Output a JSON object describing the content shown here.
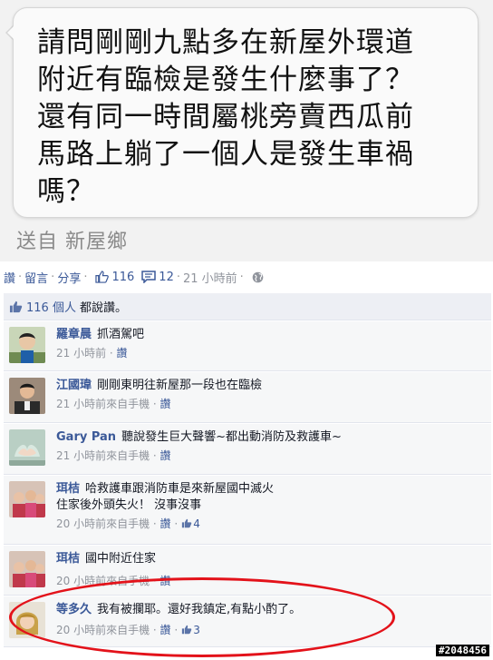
{
  "message": {
    "lines": [
      "請問剛剛九點多在新屋外環道",
      "附近有臨檢是發生什麼事了？",
      "還有同一時間屬桃旁賣西瓜前",
      "馬路上躺了一個人是發生車禍",
      "嗎？"
    ],
    "sent_from": "送自 新屋鄉"
  },
  "actions": {
    "like": "讚",
    "comment": "留言",
    "share": "分享",
    "like_count": "116",
    "comment_count": "12",
    "time": "21 小時前"
  },
  "likes_summary": {
    "count": "116 個人",
    "suffix": "都說讚。"
  },
  "comments": [
    {
      "author": "羅章晨",
      "text": "抓酒駕吧",
      "time": "21 小時前",
      "like_label": "讚",
      "likes": ""
    },
    {
      "author": "江國瑋",
      "text": "剛剛東明往新屋那一段也在臨檢",
      "time": "21 小時前來自手機",
      "like_label": "讚",
      "likes": ""
    },
    {
      "author": "Gary Pan",
      "text": "聽說發生巨大聲響~都出動消防及救護車~",
      "time": "21 小時前來自手機",
      "like_label": "讚",
      "likes": ""
    },
    {
      "author": "珥桔",
      "text": "哈救護車跟消防車是來新屋國中滅火\n住家後外頭失火！ 沒事沒事",
      "time": "20 小時前來自手機",
      "like_label": "讚",
      "likes": "4"
    },
    {
      "author": "珥桔",
      "text": "國中附近住家",
      "time": "20 小時前來自手機",
      "like_label": "讚",
      "likes": ""
    },
    {
      "author": "等多久",
      "text": "我有被攔耶。還好我鎮定,有點小酌了。",
      "time": "20 小時前來自手機",
      "like_label": "讚",
      "likes": "3"
    }
  ],
  "watermark": "#2048456",
  "colors": {
    "link": "#3b5998",
    "highlight_ellipse": "#e3121a",
    "comment_bg": "#f6f7f8"
  }
}
